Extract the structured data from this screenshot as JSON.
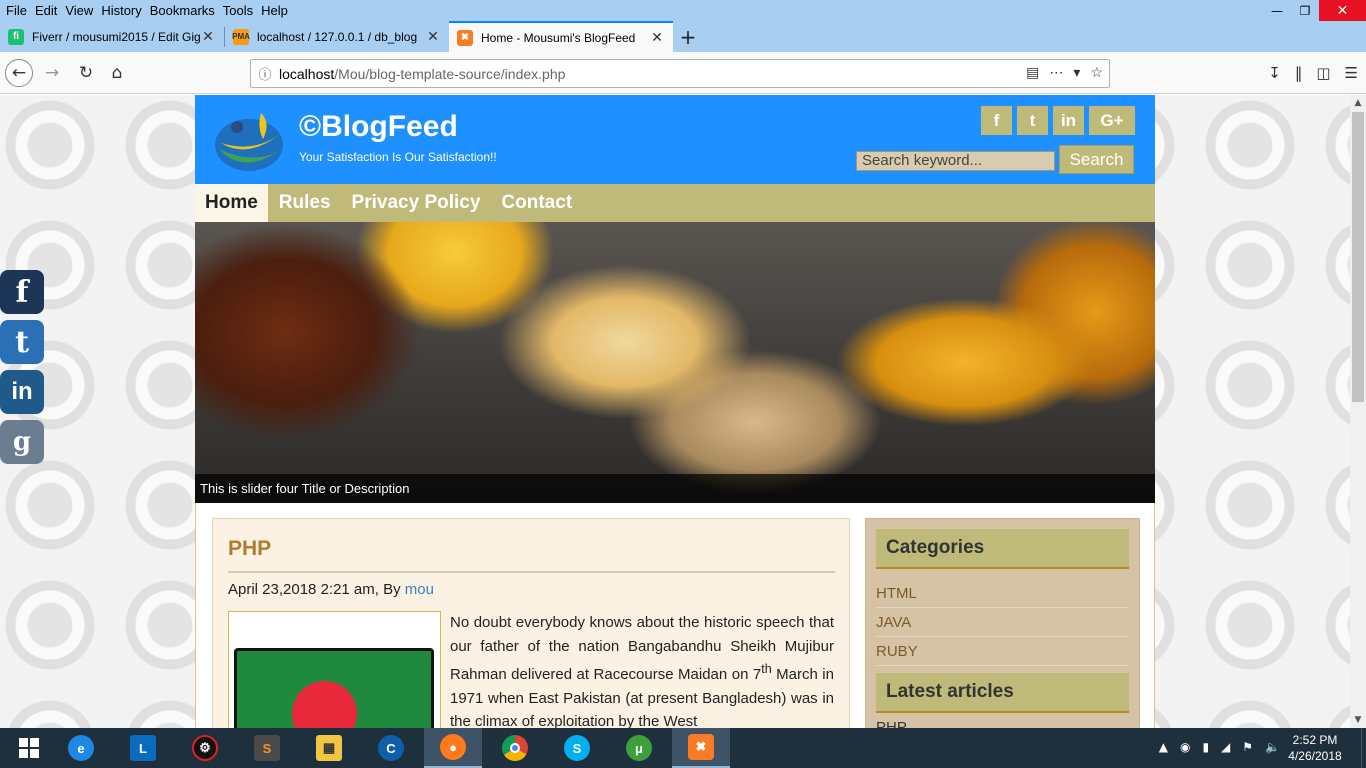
{
  "menubar": [
    "File",
    "Edit",
    "View",
    "History",
    "Bookmarks",
    "Tools",
    "Help"
  ],
  "tabs": [
    {
      "title": "Fiverr / mousumi2015 / Edit Gig",
      "icon": "fiverr-icon",
      "color": "#1dbf73"
    },
    {
      "title": "localhost / 127.0.0.1 / db_blog",
      "icon": "phpmyadmin-icon",
      "color": "#f89c0e"
    },
    {
      "title": "Home - Mousumi's BlogFeed",
      "icon": "xampp-icon",
      "color": "#fb7a24"
    }
  ],
  "url": {
    "host": "localhost",
    "path": "/Mou/blog-template-source/index.php"
  },
  "site": {
    "title": "©BlogFeed",
    "tagline": "Your Satisfaction Is Our Satisfaction!!",
    "social": [
      "f",
      "t",
      "in",
      "G+"
    ],
    "search_placeholder": "Search keyword...",
    "search_button": "Search",
    "nav": [
      "Home",
      "Rules",
      "Privacy Policy",
      "Contact"
    ],
    "slider_caption": "This is slider four Title or Description"
  },
  "post": {
    "title": "PHP",
    "meta_prefix": "April 23,2018 2:21 am, By ",
    "author": "mou",
    "body_1": "No doubt everybody knows about the historic speech that our father of the nation Bangabandhu Sheikh Mujibur Rahman delivered at Racecourse Maidan on 7",
    "body_sup": "th",
    "body_2": " March in 1971 when East Pakistan (at present Bangladesh) was in the climax of exploitation by the West"
  },
  "sidebar": {
    "categories_title": "Categories",
    "categories": [
      "HTML",
      "JAVA",
      "RUBY"
    ],
    "latest_title": "Latest articles",
    "latest_first": "PHP"
  },
  "taskbar": {
    "time": "2:52 PM",
    "date": "4/26/2018"
  }
}
